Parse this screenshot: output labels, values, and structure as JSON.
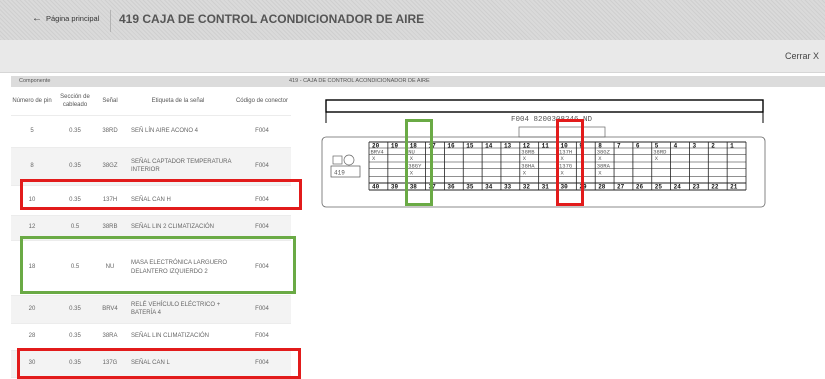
{
  "header": {
    "back_label": "Página principal",
    "title": "419 CAJA DE CONTROL ACONDICIONADOR DE AIRE"
  },
  "close_label": "Cerrar X",
  "components_label": "Componente",
  "table": {
    "columns": [
      "Número de pin",
      "Sección de cableado",
      "Señal",
      "Etiqueta de la señal",
      "Código de conector"
    ],
    "rows": [
      {
        "pin": "5",
        "section": "0.35",
        "signal": "38RD",
        "label": "SEÑ LÍN AIRE ACONO 4",
        "connector": "F004"
      },
      {
        "pin": "8",
        "section": "0.35",
        "signal": "38GZ",
        "label": "SEÑAL CAPTADOR TEMPERATURA INTERIOR",
        "connector": "F004"
      },
      {
        "pin": "10",
        "section": "0.35",
        "signal": "137H",
        "label": "SEÑAL CAN H",
        "connector": "F004"
      },
      {
        "pin": "12",
        "section": "0.5",
        "signal": "38RB",
        "label": "SEÑAL LIN 2 CLIMATIZACIÓN",
        "connector": "F004"
      },
      {
        "pin": "18",
        "section": "0.5",
        "signal": "NU",
        "label": "MASA ELECTRÓNICA LARGUERO DELANTERO IZQUIERDO 2",
        "connector": "F004"
      },
      {
        "pin": "20",
        "section": "0.35",
        "signal": "BRV4",
        "label": "RELÉ VEHÍCULO ELÉCTRICO + BATERÍA 4",
        "connector": "F004"
      },
      {
        "pin": "28",
        "section": "0.35",
        "signal": "38RA",
        "label": "SEÑAL LIN CLIMATIZACIÓN",
        "connector": "F004"
      },
      {
        "pin": "30",
        "section": "0.35",
        "signal": "137G",
        "label": "SEÑAL CAN L",
        "connector": "F004"
      }
    ]
  },
  "diagram": {
    "header": "419 - CAJA DE CONTROL ACONDICIONADOR DE AIRE",
    "connector_ref": "F004  8200308246 ND",
    "component_num": "419",
    "top_pins": [
      "20",
      "19",
      "18",
      "17",
      "16",
      "15",
      "14",
      "13",
      "12",
      "11",
      "10",
      "9",
      "8",
      "7",
      "6",
      "5",
      "4",
      "3",
      "2",
      "1"
    ],
    "bottom_pins": [
      "40",
      "39",
      "38",
      "37",
      "36",
      "35",
      "34",
      "33",
      "32",
      "31",
      "30",
      "29",
      "28",
      "27",
      "26",
      "25",
      "24",
      "23",
      "22",
      "21"
    ],
    "top_signals": {
      "20": "BRV4",
      "18": "NU",
      "12": "38RB",
      "10": "137H",
      "8": "38GZ",
      "5": "38RD"
    },
    "bottom_signals": {
      "38": "38GY",
      "32": "38HA",
      "30": "137G",
      "28": "38RA"
    },
    "mark": "X"
  }
}
